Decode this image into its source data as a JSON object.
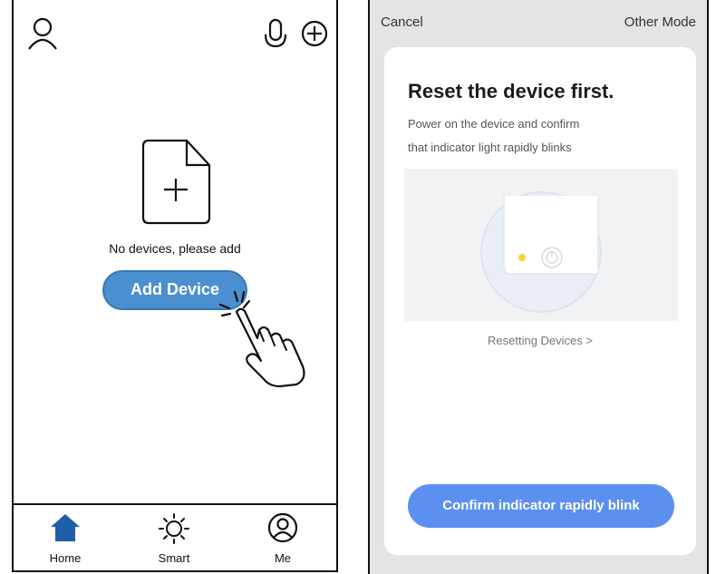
{
  "left_app": {
    "empty_state_text": "No devices, please add",
    "add_button_label": "Add Device",
    "tabs": [
      {
        "label": "Home",
        "icon": "home-icon",
        "active": true
      },
      {
        "label": "Smart",
        "icon": "sun-icon",
        "active": false
      },
      {
        "label": "Me",
        "icon": "user-circle-icon",
        "active": false
      }
    ],
    "colors": {
      "accent": "#4a8fd0",
      "home_icon": "#1f5fa8"
    }
  },
  "right_app": {
    "nav": {
      "cancel": "Cancel",
      "other_mode": "Other Mode"
    },
    "title": "Reset the device first.",
    "description_line1": "Power on the device and confirm",
    "description_line2": "that indicator light rapidly blinks",
    "reset_link": "Resetting Devices >",
    "confirm_button": "Confirm indicator rapidly blink",
    "colors": {
      "button": "#5b8ff0",
      "indicator": "#f5d630"
    }
  }
}
